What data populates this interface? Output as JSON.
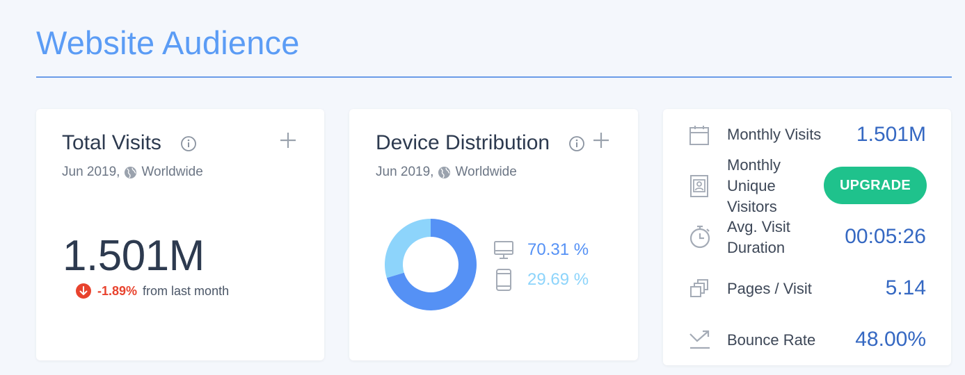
{
  "page": {
    "title": "Website Audience"
  },
  "total_visits": {
    "title": "Total Visits",
    "date": "Jun 2019,",
    "region": "Worldwide",
    "value": "1.501M",
    "change": "-1.89%",
    "change_text": "from last month",
    "icons": {
      "info": "info-icon",
      "add": "plus-icon",
      "globe": "globe-icon",
      "change": "arrow-down-circle-icon"
    }
  },
  "device_distribution": {
    "title": "Device Distribution",
    "date": "Jun 2019,",
    "region": "Worldwide",
    "desktop_pct": "70.31 %",
    "mobile_pct": "29.69 %",
    "colors": {
      "desktop": "#5591f5",
      "mobile": "#8dd4fb"
    },
    "chart_data": {
      "type": "pie",
      "categories": [
        "Desktop",
        "Mobile"
      ],
      "values": [
        70.31,
        29.69
      ]
    }
  },
  "metrics": {
    "monthly_visits": {
      "label": "Monthly Visits",
      "value": "1.501M",
      "icon": "calendar-icon"
    },
    "unique_visitors": {
      "label_lines": [
        "Monthly",
        "Unique",
        "Visitors"
      ],
      "button": "UPGRADE",
      "icon": "id-badge-icon"
    },
    "avg_duration": {
      "label_lines": [
        "Avg. Visit",
        "Duration"
      ],
      "value": "00:05:26",
      "icon": "stopwatch-icon"
    },
    "pages_per_visit": {
      "label": "Pages / Visit",
      "value": "5.14",
      "icon": "pages-icon"
    },
    "bounce_rate": {
      "label": "Bounce Rate",
      "value": "48.00%",
      "icon": "bounce-icon"
    }
  },
  "colors": {
    "accent": "#5b9cf5",
    "value_blue": "#3568c2",
    "negative": "#e8432e",
    "upgrade": "#1fc28c"
  }
}
